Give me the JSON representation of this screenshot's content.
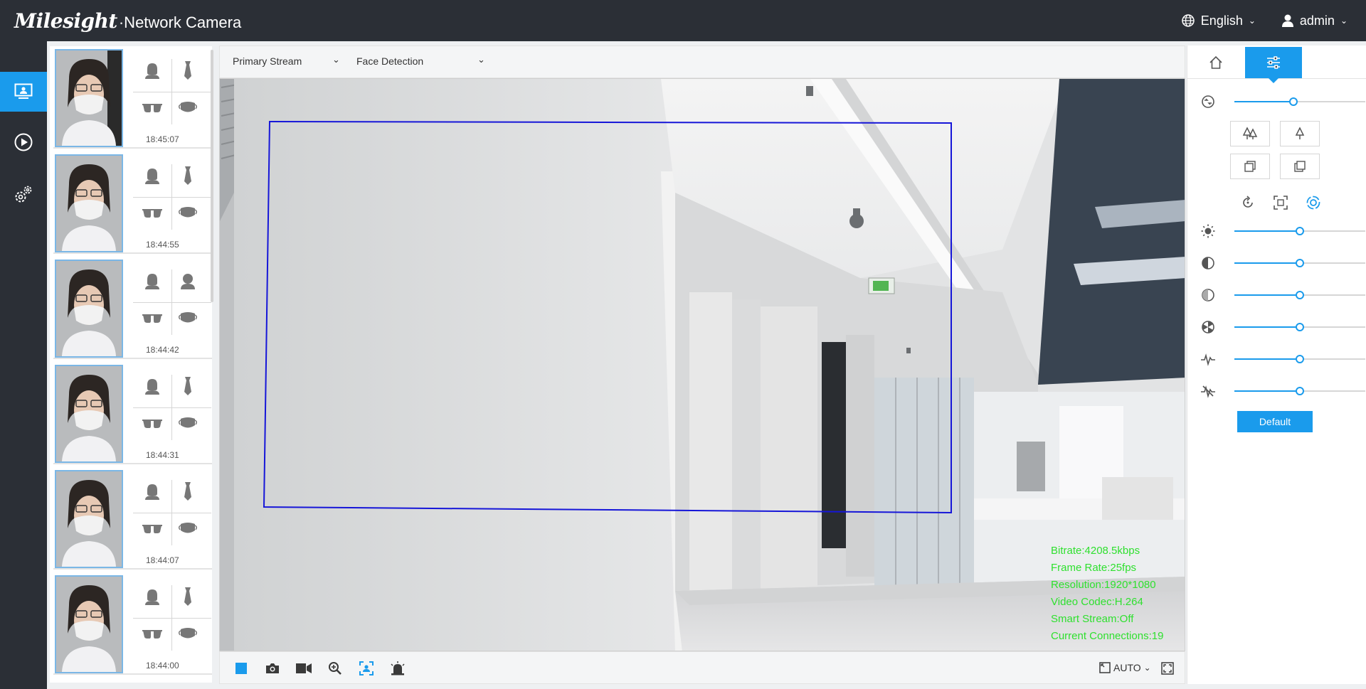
{
  "header": {
    "brand": "Milesight",
    "product": "·Network Camera",
    "language": "English",
    "user": "admin"
  },
  "nav": {
    "items": [
      {
        "name": "live-view",
        "icon": "monitor-icon",
        "active": true
      },
      {
        "name": "playback",
        "icon": "play-circle-icon",
        "active": false
      },
      {
        "name": "settings",
        "icon": "gears-icon",
        "active": false
      }
    ]
  },
  "snapshots": [
    {
      "time": "18:45:07",
      "attributes": [
        "person",
        "tie",
        "glasses",
        "mask"
      ]
    },
    {
      "time": "18:44:55",
      "attributes": [
        "person",
        "tie",
        "glasses",
        "mask"
      ]
    },
    {
      "time": "18:44:42",
      "attributes": [
        "person",
        "female",
        "glasses",
        "mask"
      ]
    },
    {
      "time": "18:44:31",
      "attributes": [
        "person",
        "tie",
        "glasses",
        "mask"
      ]
    },
    {
      "time": "18:44:07",
      "attributes": [
        "person",
        "tie",
        "glasses",
        "mask"
      ]
    },
    {
      "time": "18:44:00",
      "attributes": [
        "person",
        "tie",
        "glasses",
        "mask"
      ]
    }
  ],
  "stream": {
    "stream_select": "Primary Stream",
    "mode_select": "Face Detection"
  },
  "osd": {
    "bitrate": "Bitrate:4208.5kbps",
    "frame_rate": "Frame Rate:25fps",
    "resolution": "Resolution:1920*1080",
    "video_codec": "Video Codec:H.264",
    "smart_stream": "Smart Stream:Off",
    "connections": "Current Connections:19"
  },
  "bottom_toolbar": {
    "zoom_mode": "AUTO"
  },
  "image_panel": {
    "zoom_level": 0.45,
    "brightness": 0.5,
    "contrast": 0.5,
    "saturation": 0.5,
    "sharpness": 0.5,
    "noise": 0.5,
    "wdr": 0.5,
    "default_label": "Default"
  },
  "colors": {
    "accent": "#1a9bec",
    "topbar": "#2b2f36",
    "osd_text": "#2fe02f",
    "detect_box": "#1616d8"
  }
}
